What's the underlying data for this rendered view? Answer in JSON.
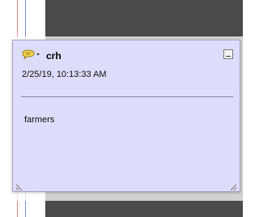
{
  "note": {
    "author": "crh",
    "timestamp": "2/25/19, 10:13:33 AM",
    "content": "farmers",
    "icon": "comment-bubble-icon"
  },
  "colors": {
    "note_background": "#dddcfa",
    "dark_background": "#4a4a4a",
    "margin_red": "#e08a8a",
    "margin_blue": "#7f8ad6",
    "icon_yellow": "#f2d24a"
  }
}
